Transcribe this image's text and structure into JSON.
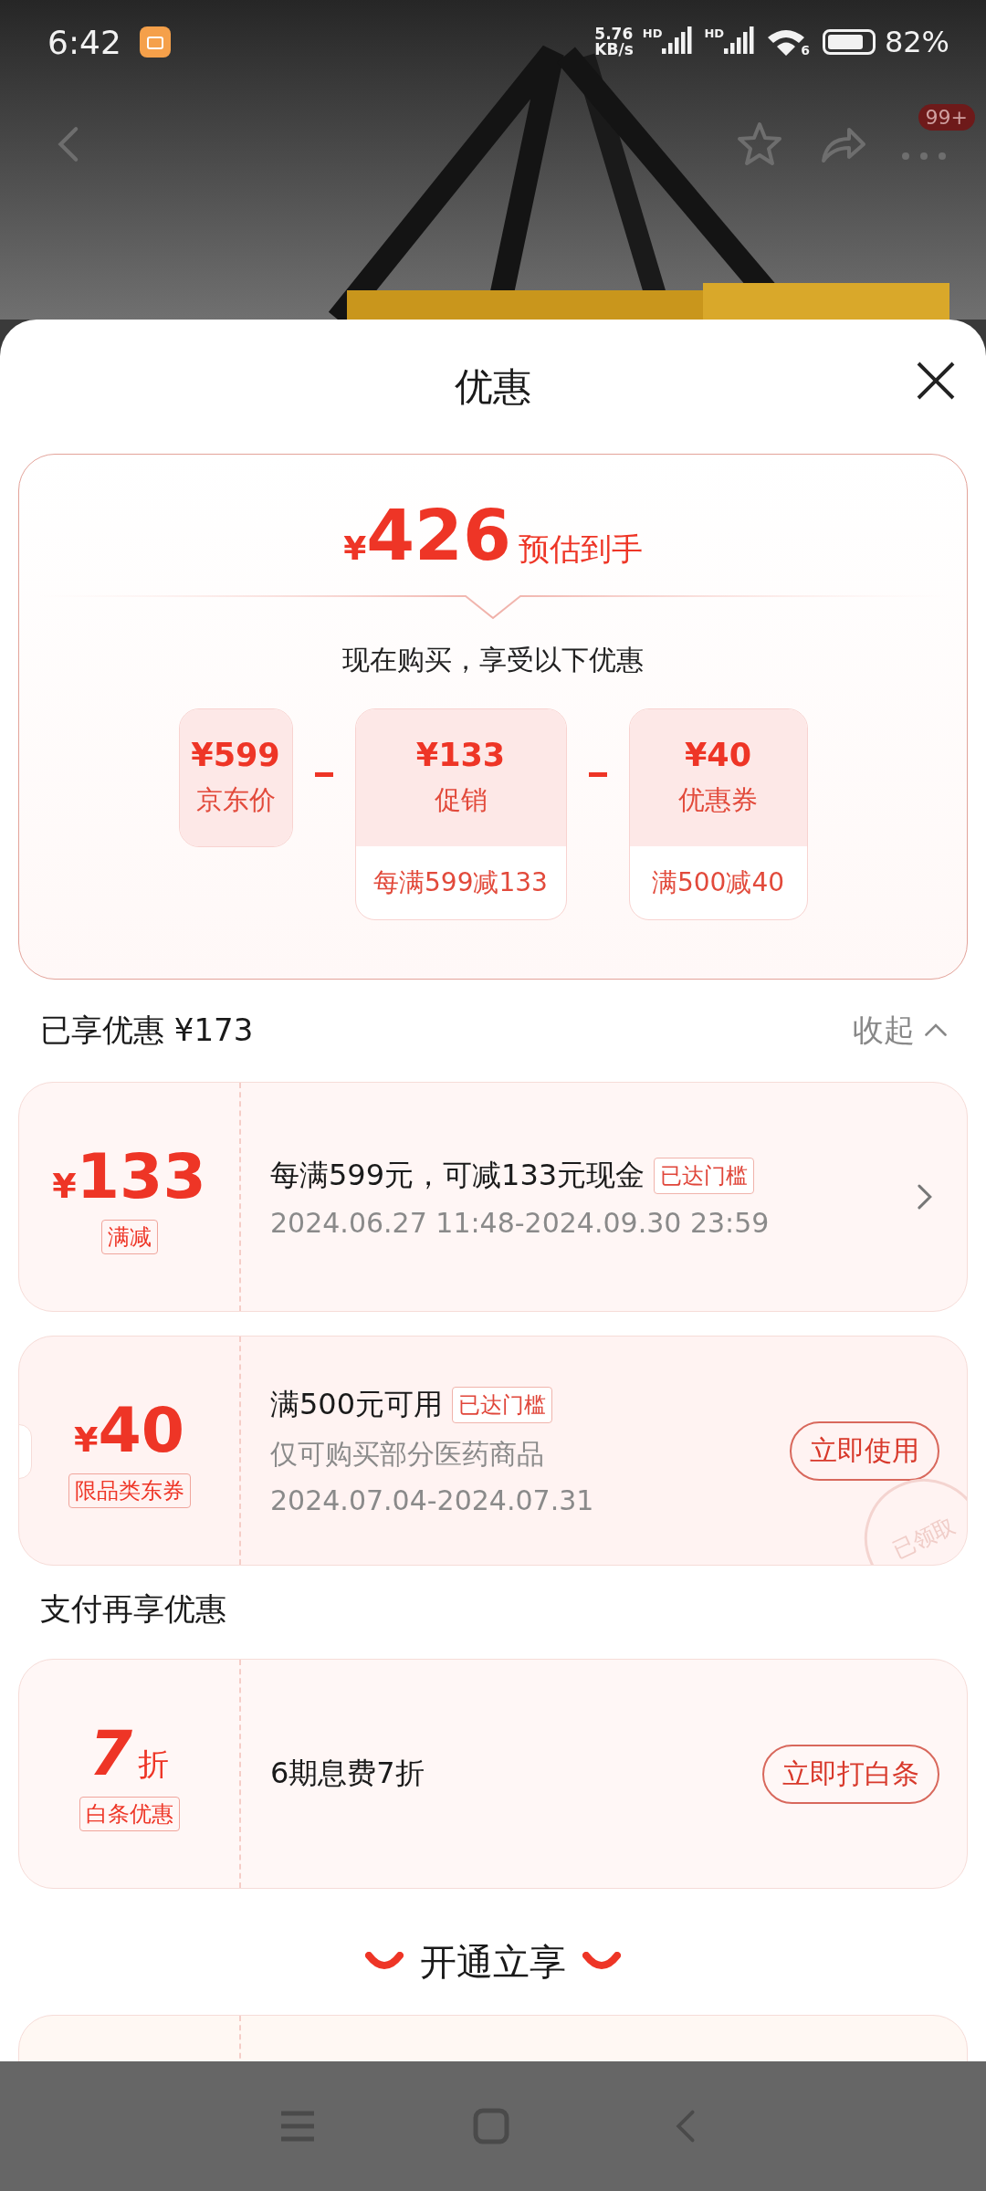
{
  "status_bar": {
    "time": "6:42",
    "net_speed": [
      "5.76",
      "KB/s"
    ],
    "signals": [
      {
        "label": "HD"
      },
      {
        "label": "HD"
      }
    ],
    "wifi_label": "6",
    "battery": "82%"
  },
  "top_bar": {
    "badge": "99+"
  },
  "sheet": {
    "title": "优惠"
  },
  "summary": {
    "currency": "¥",
    "amount": "426",
    "note": "预估到手",
    "subtitle": "现在购买，享受以下优惠",
    "items": [
      {
        "amount": "¥599",
        "label": "京东价"
      },
      {
        "amount": "¥133",
        "label": "促销",
        "detail": "每满599减133"
      },
      {
        "amount": "¥40",
        "label": "优惠券",
        "detail": "满500减40"
      }
    ]
  },
  "enjoyed": {
    "title": "已享优惠 ¥173",
    "toggle": "收起",
    "expanded": true,
    "coupons": [
      {
        "kind": "promo",
        "currency": "¥",
        "amount": "133",
        "tag": "满减",
        "title": "每满599元，可减133元现金",
        "badge": "已达门槛",
        "lines": [
          "2024.06.27 11:48-2024.09.30 23:59"
        ]
      },
      {
        "kind": "coupon",
        "currency": "¥",
        "amount": "40",
        "tag": "限品类东券",
        "title": "满500元可用",
        "badge": "已达门槛",
        "lines": [
          "仅可购买部分医药商品",
          "2024.07.04-2024.07.31"
        ],
        "action": "立即使用",
        "stamp": "已领取"
      }
    ]
  },
  "pay": {
    "title": "支付再享优惠",
    "coupons": [
      {
        "kind": "discount",
        "amount": "7",
        "unit": "折",
        "tag": "白条优惠",
        "title": "6期息费7折",
        "action": "立即打白条"
      }
    ]
  },
  "open": {
    "title": "开通立享"
  }
}
